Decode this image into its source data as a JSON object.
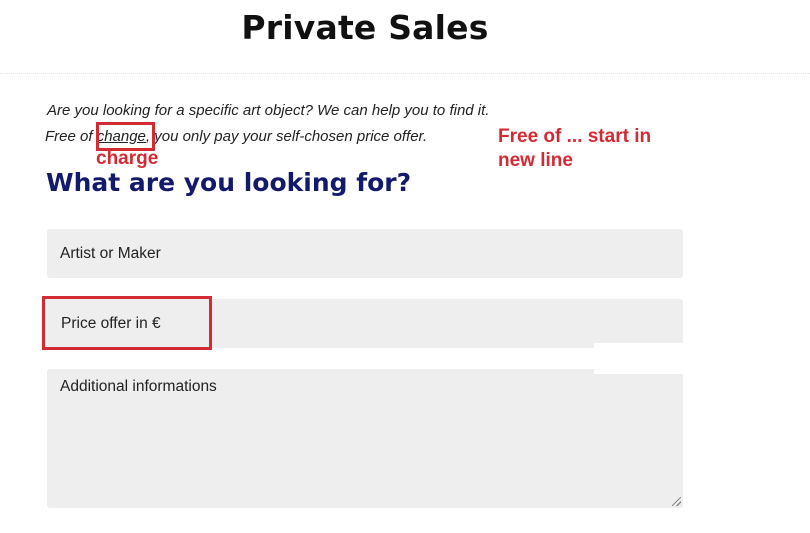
{
  "page": {
    "title": "Private Sales"
  },
  "intro": {
    "line1": "Are you looking for a specific art object? We can help you to find it.",
    "line2_prefix": "Free of ",
    "line2_highlight": "change",
    "line2_suffix": ", you only pay your self-chosen price offer."
  },
  "annotations": {
    "charge": "charge",
    "new_line_note": "Free of ... start in new line",
    "color": "#d42a34"
  },
  "form": {
    "heading": "What are you looking for?",
    "artist_placeholder": "Artist or Maker",
    "price_placeholder": "Price offer in €",
    "info_placeholder": "Additional informations"
  },
  "colors": {
    "heading": "#131a6b",
    "field_background": "#eeeeee"
  }
}
